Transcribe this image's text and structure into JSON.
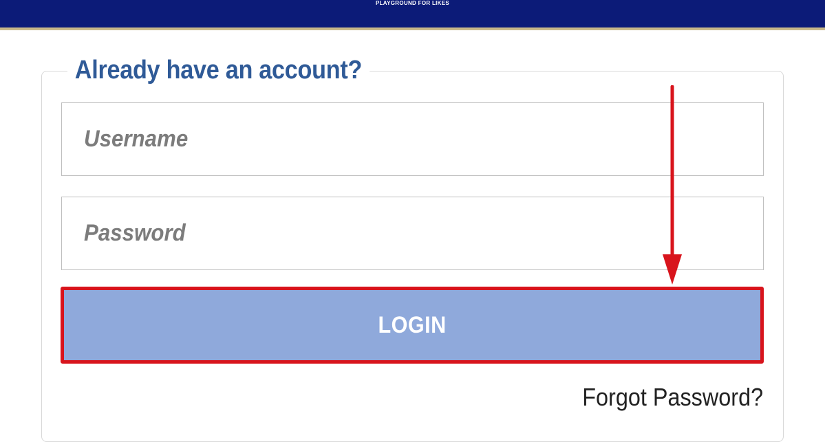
{
  "header": {
    "tagline": "PLAYGROUND FOR LIKES",
    "background_color": "#0c1b78"
  },
  "login_form": {
    "legend": "Already have an account?",
    "username": {
      "placeholder": "Username",
      "value": ""
    },
    "password": {
      "placeholder": "Password",
      "value": ""
    },
    "login_button_label": "LOGIN",
    "forgot_password_label": "Forgot Password?"
  },
  "annotation": {
    "highlight_color": "#d8141c",
    "arrow_icon": "down-arrow-icon"
  }
}
